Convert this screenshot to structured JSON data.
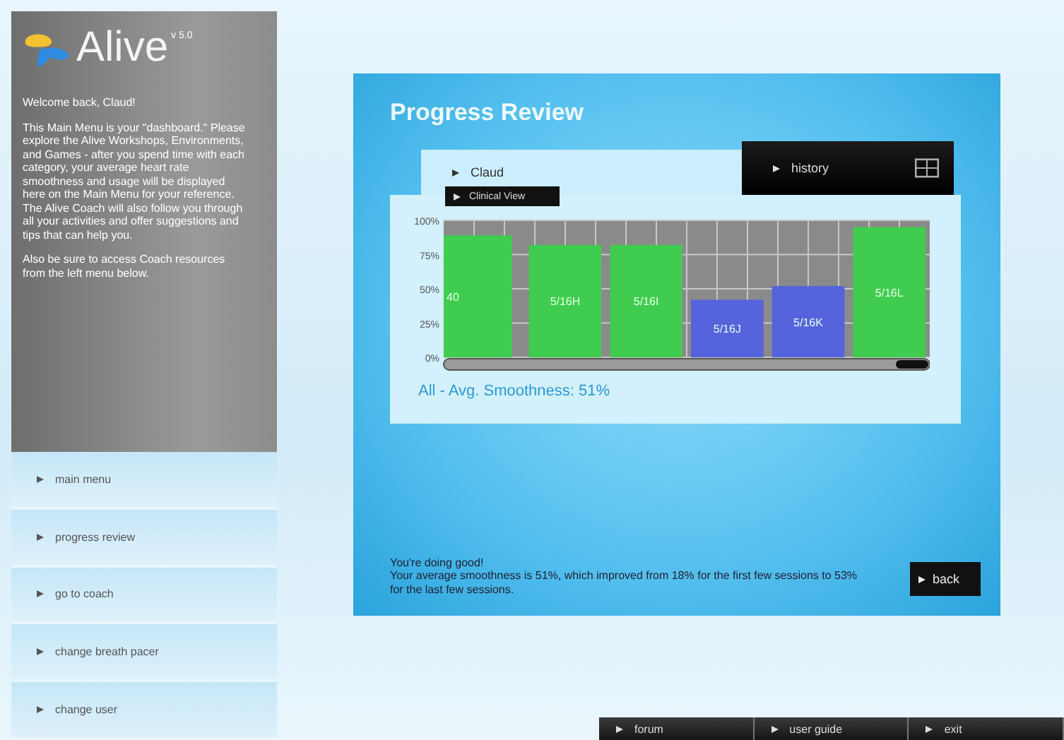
{
  "app": {
    "logo": "Alive",
    "version": "v 5.0"
  },
  "sidebar": {
    "welcome": "Welcome back, Claud!",
    "intro": "This Main Menu is your \"dashboard.\" Please explore the Alive Workshops, Environments, and Games - after you spend time with each category, your average heart rate smoothness and usage will be displayed here on the Main Menu for your reference. The Alive Coach will also follow you through all your activities and offer suggestions and tips that can help you.",
    "note": "Also be sure to access Coach resources from the left menu below.",
    "items": [
      {
        "label": "main menu"
      },
      {
        "label": "progress review"
      },
      {
        "label": "go to coach"
      },
      {
        "label": "change breath pacer"
      },
      {
        "label": "change user"
      }
    ]
  },
  "panel": {
    "title": "Progress Review",
    "tabs": [
      {
        "label": "Claud",
        "selected": true
      },
      {
        "label": "history",
        "selected": false
      }
    ],
    "view_tab": "Clinical View",
    "chart_data": {
      "type": "bar",
      "categories": [
        "40",
        "5/16H",
        "5/16I",
        "5/16J",
        "5/16K",
        "5/16L"
      ],
      "ylim": [
        0,
        100
      ],
      "yticks": [
        {
          "value": 0,
          "label": "0%"
        },
        {
          "value": 25,
          "label": "25%"
        },
        {
          "value": 50,
          "label": "50%"
        },
        {
          "value": 75,
          "label": "75%"
        },
        {
          "value": 100,
          "label": "100%"
        }
      ],
      "series": [
        {
          "color": "#3fcc4f",
          "values": [
            89,
            82,
            82,
            null,
            null,
            95
          ]
        },
        {
          "color": "#5563dd",
          "values": [
            null,
            null,
            null,
            42,
            52,
            null
          ]
        }
      ],
      "grid": true
    },
    "summary": "All - Avg. Smoothness: 51%",
    "message": [
      "You're doing good!",
      "Your average smoothness is 51%, which improved from 18% for the first few sessions to 53% for the last few sessions."
    ],
    "back": "back"
  },
  "footer": [
    {
      "label": "forum"
    },
    {
      "label": "user guide"
    },
    {
      "label": "exit"
    }
  ]
}
